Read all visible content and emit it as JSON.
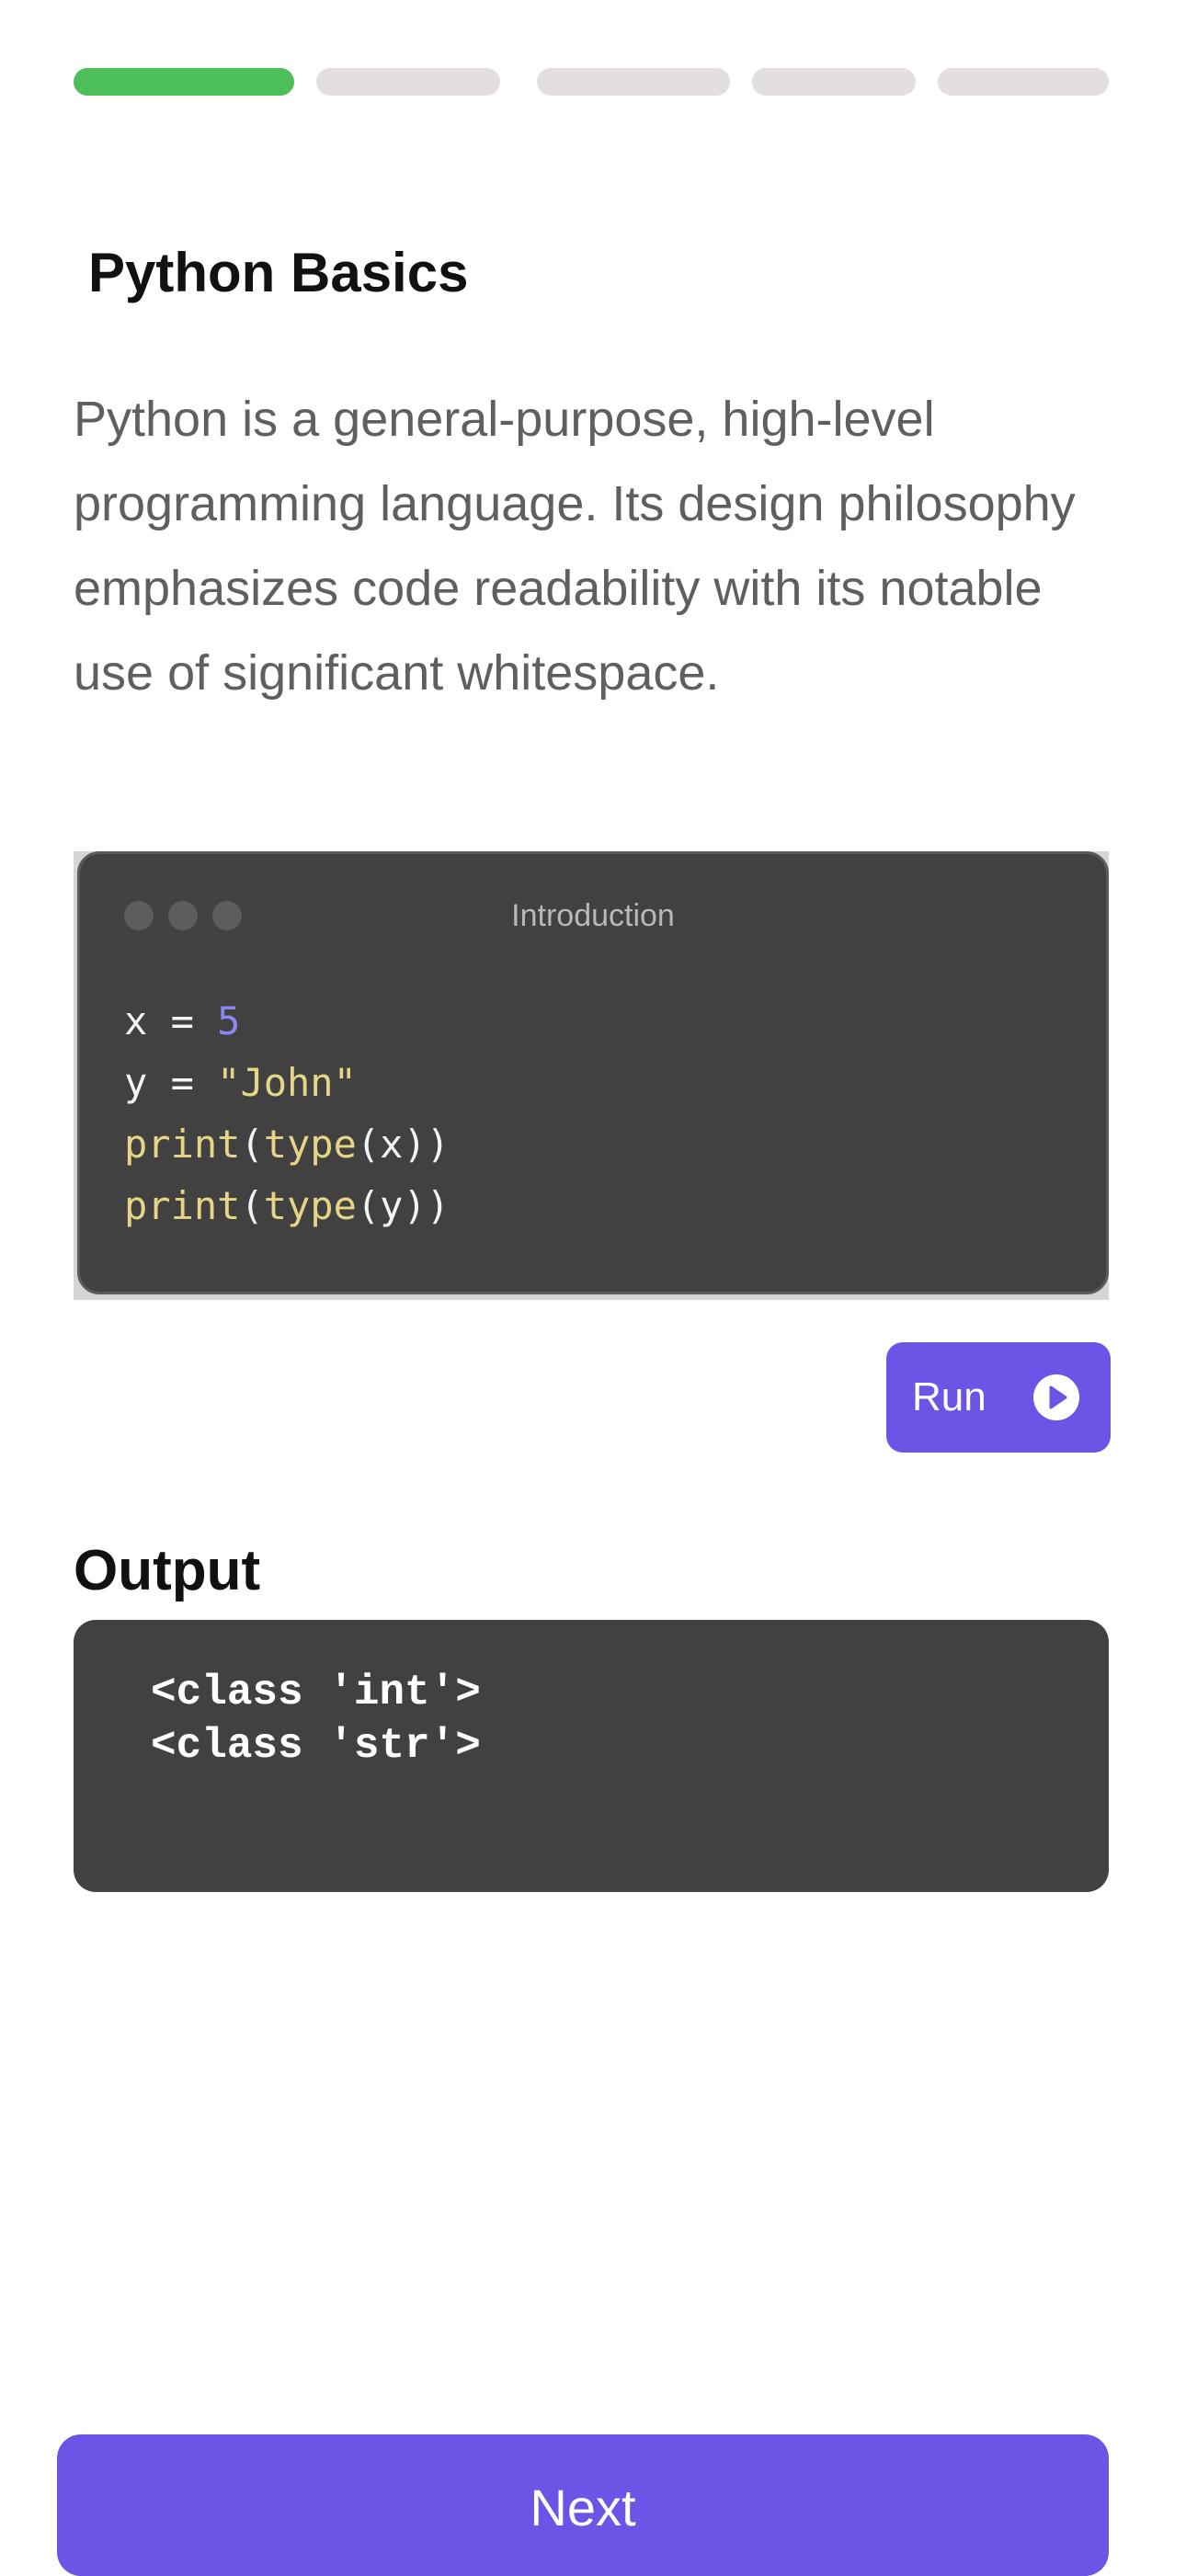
{
  "progress": {
    "total_steps": 5,
    "completed_steps": 1,
    "completed_color": "#4cbf5a",
    "pending_color": "#e3dfe0"
  },
  "lesson": {
    "title": "Python Basics",
    "description": "Python is a general-purpose, high-level programming language. Its design philosophy emphasizes code readability with its notable use of significant whitespace."
  },
  "code_window": {
    "title": "Introduction",
    "lines": [
      [
        {
          "text": "x = ",
          "kind": "plain"
        },
        {
          "text": "5",
          "kind": "num"
        }
      ],
      [
        {
          "text": "y = ",
          "kind": "plain"
        },
        {
          "text": "\"John\"",
          "kind": "str"
        }
      ],
      [
        {
          "text": "print",
          "kind": "fn"
        },
        {
          "text": "(",
          "kind": "plain"
        },
        {
          "text": "type",
          "kind": "fn"
        },
        {
          "text": "(x))",
          "kind": "plain"
        }
      ],
      [
        {
          "text": "print",
          "kind": "fn"
        },
        {
          "text": "(",
          "kind": "plain"
        },
        {
          "text": "type",
          "kind": "fn"
        },
        {
          "text": "(y))",
          "kind": "plain"
        }
      ]
    ]
  },
  "run_button": {
    "label": "Run",
    "icon": "play-circle-icon"
  },
  "output": {
    "heading": "Output",
    "lines": [
      "<class 'int'>",
      "<class 'str'>"
    ]
  },
  "next_button": {
    "label": "Next"
  },
  "colors": {
    "accent": "#6a55e6",
    "code_background": "#414141",
    "number": "#8b86f2",
    "string": "#e6d487"
  }
}
